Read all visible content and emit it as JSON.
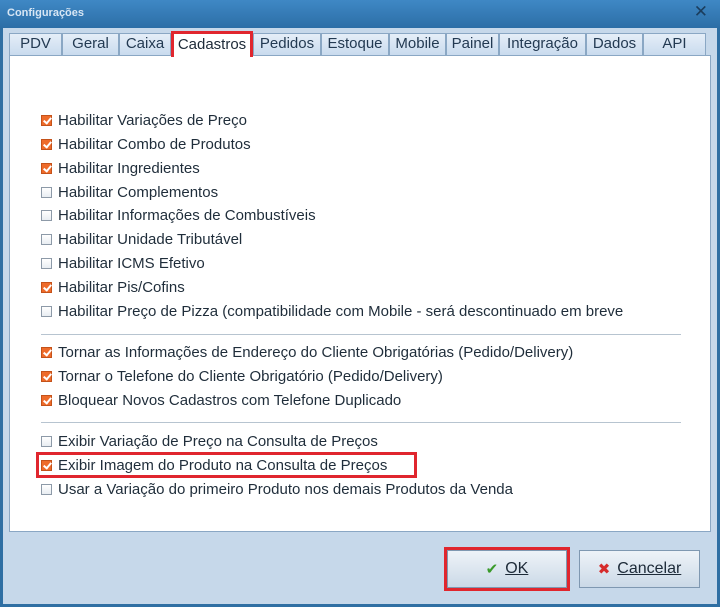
{
  "window": {
    "title": "Configurações",
    "close_glyph": "✕"
  },
  "tabs": [
    {
      "label": "PDV"
    },
    {
      "label": "Geral"
    },
    {
      "label": "Caixa"
    },
    {
      "label": "Cadastros",
      "active": true
    },
    {
      "label": "Pedidos"
    },
    {
      "label": "Estoque"
    },
    {
      "label": "Mobile"
    },
    {
      "label": "Painel"
    },
    {
      "label": "Integração"
    },
    {
      "label": "Dados"
    },
    {
      "label": "API"
    }
  ],
  "groups": [
    {
      "items": [
        {
          "label": "Habilitar Variações de Preço",
          "checked": true
        },
        {
          "label": "Habilitar Combo de Produtos",
          "checked": true
        },
        {
          "label": "Habilitar Ingredientes",
          "checked": true
        },
        {
          "label": "Habilitar Complementos",
          "checked": false
        },
        {
          "label": "Habilitar Informações de Combustíveis",
          "checked": false
        },
        {
          "label": "Habilitar Unidade Tributável",
          "checked": false
        },
        {
          "label": "Habilitar ICMS Efetivo",
          "checked": false
        },
        {
          "label": "Habilitar Pis/Cofins",
          "checked": true
        },
        {
          "label": "Habilitar Preço de Pizza (compatibilidade com Mobile - será descontinuado em breve",
          "checked": false
        }
      ]
    },
    {
      "items": [
        {
          "label": "Tornar as Informações de Endereço do Cliente Obrigatórias (Pedido/Delivery)",
          "checked": true
        },
        {
          "label": "Tornar o Telefone do Cliente Obrigatório (Pedido/Delivery)",
          "checked": true
        },
        {
          "label": "Bloquear Novos Cadastros com Telefone Duplicado",
          "checked": true
        }
      ]
    },
    {
      "items": [
        {
          "label": "Exibir Variação de Preço na Consulta de Preços",
          "checked": false
        },
        {
          "label": "Exibir Imagem do Produto na Consulta de Preços",
          "checked": true
        },
        {
          "label": "Usar a Variação do primeiro Produto nos demais Produtos da Venda",
          "checked": false
        }
      ]
    }
  ],
  "buttons": {
    "ok": {
      "label": "OK",
      "icon": "check-icon",
      "icon_glyph": "✔",
      "icon_color": "#3a9a2a"
    },
    "cancel": {
      "label": "Cancelar",
      "icon": "x-icon",
      "icon_glyph": "✖",
      "icon_color": "#d62b2b"
    }
  },
  "colors": {
    "highlight": "#e0262e",
    "checkbox_checked": "#ee6b2a",
    "title_bar": "#2f6fa3"
  }
}
